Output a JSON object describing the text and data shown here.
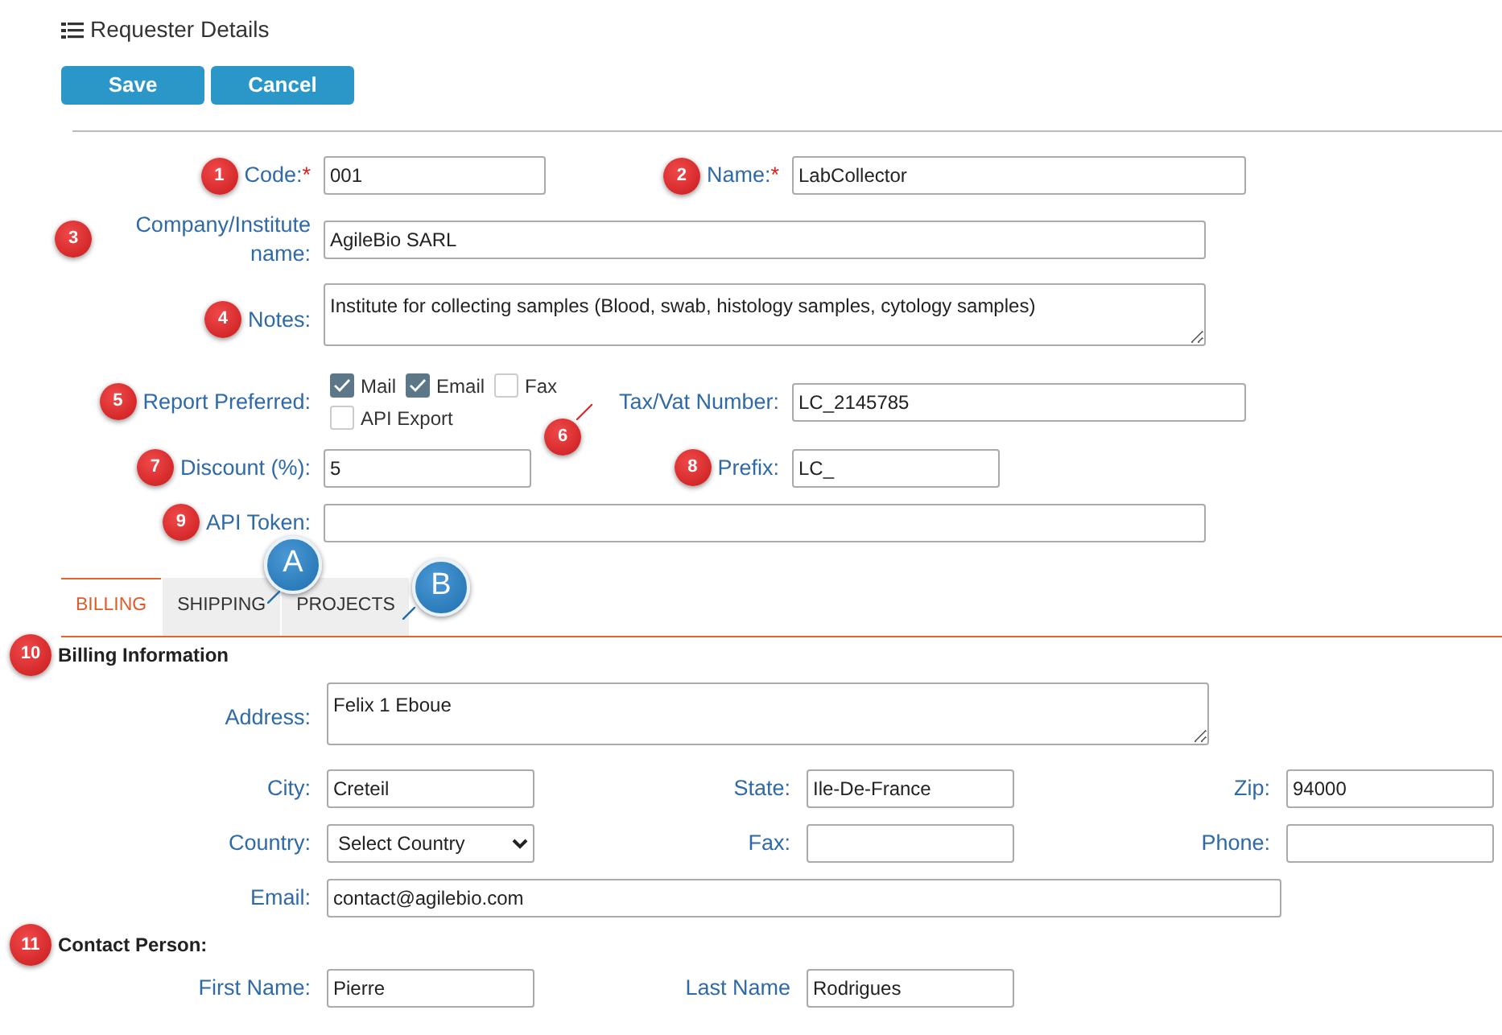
{
  "title": "Requester Details",
  "buttons": [
    "Save",
    "Cancel"
  ],
  "fields": [
    {
      "kind": "text",
      "label": "Code:",
      "required_mark": "*",
      "value": "001",
      "callout": "1"
    },
    {
      "kind": "text",
      "label": "Name:",
      "required_mark": "*",
      "value": "LabCollector",
      "callout": "2"
    },
    {
      "kind": "text",
      "label": "Company/Institute name:",
      "value": "AgileBio SARL",
      "callout": "3"
    },
    {
      "kind": "textarea",
      "label": "Notes:",
      "value": "Institute for collecting samples (Blood, swab, histology samples, cytology samples)",
      "callout": "4"
    },
    {
      "kind": "checkboxes",
      "label": "Report Preferred:",
      "callout": "5",
      "options": [
        {
          "label": "Mail",
          "checked": true
        },
        {
          "label": "Email",
          "checked": true
        },
        {
          "label": "Fax",
          "checked": false
        },
        {
          "label": "API Export",
          "checked": false
        }
      ]
    },
    {
      "kind": "text",
      "label": "Tax/Vat Number:",
      "value": "LC_2145785",
      "callout": "6"
    },
    {
      "kind": "text",
      "label": "Discount (%):",
      "value": "5",
      "callout": "7"
    },
    {
      "kind": "text",
      "label": "Prefix:",
      "value": "LC_",
      "callout": "8"
    },
    {
      "kind": "text",
      "label": "API Token:",
      "callout": "9"
    }
  ],
  "tabs": [
    {
      "label": "BILLING",
      "selected": true
    },
    {
      "label": "SHIPPING",
      "selected": false,
      "callout": "A"
    },
    {
      "label": "PROJECTS",
      "selected": false,
      "callout": "B"
    }
  ],
  "billing": {
    "callout": "10",
    "title": "Billing Information",
    "fields": [
      {
        "kind": "textarea",
        "label": "Address:",
        "value": "Felix 1 Eboue"
      },
      {
        "kind": "text",
        "label": "City:",
        "value": "Creteil"
      },
      {
        "kind": "text",
        "label": "State:",
        "value": "Ile-De-France"
      },
      {
        "kind": "text",
        "label": "Zip:",
        "value": "94000"
      },
      {
        "kind": "select",
        "label": "Country:",
        "value": "Select Country"
      },
      {
        "kind": "text",
        "label": "Fax:"
      },
      {
        "kind": "text",
        "label": "Phone:"
      },
      {
        "kind": "text",
        "label": "Email:",
        "value": "contact@agilebio.com"
      }
    ]
  },
  "contact": {
    "callout": "11",
    "title": "Contact Person:",
    "fields": [
      {
        "kind": "text",
        "label": "First Name:",
        "value": "Pierre"
      },
      {
        "kind": "text",
        "label": "Last Name",
        "value": "Rodrigues"
      }
    ]
  }
}
